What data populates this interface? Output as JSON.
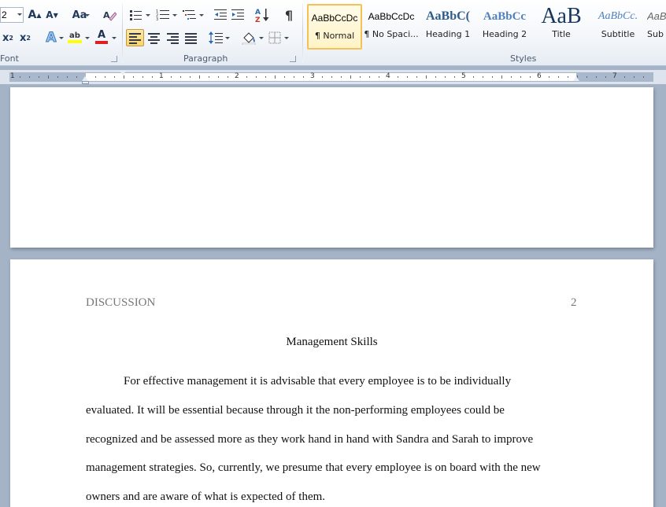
{
  "ribbon": {
    "font_size_value": "2",
    "groups": {
      "font": "Font",
      "paragraph": "Paragraph",
      "styles": "Styles"
    },
    "buttons": {
      "grow_font": "A",
      "shrink_font": "A",
      "change_case": "Aa",
      "subscript": "x",
      "superscript": "x",
      "text_effects": "A",
      "highlight": "ab",
      "font_color": "A",
      "sort": "A",
      "show_marks": "¶"
    },
    "styles": [
      {
        "sample": "AaBbCcDc",
        "name": "¶ Normal"
      },
      {
        "sample": "AaBbCcDc",
        "name": "¶ No Spaci..."
      },
      {
        "sample": "AaBbC(",
        "name": "Heading 1"
      },
      {
        "sample": "AaBbCc",
        "name": "Heading 2"
      },
      {
        "sample": "AaB",
        "name": "Title"
      },
      {
        "sample": "AaBbCc.",
        "name": "Subtitle"
      },
      {
        "sample": "AaBbC",
        "name": "Sub"
      }
    ],
    "colors": {
      "highlight": "#ffff00",
      "font_color": "#e02020",
      "heading": "#2e5c8a",
      "title": "#17365d"
    }
  },
  "ruler": {
    "numbers": [
      "1",
      "1",
      "2",
      "3",
      "4",
      "5",
      "6",
      "7"
    ]
  },
  "document": {
    "header": {
      "running_head": "DISCUSSION",
      "page_number": "2"
    },
    "title": "Management Skills",
    "lines": [
      "For effective management it is advisable that every employee is to be individually",
      "evaluated.  It will be essential because through it the non-performing  employees could be",
      "recognized and be assessed more as they work hand in hand with Sandra and Sarah to improve",
      "management strategies. So, currently, we presume that every employee is on board with the new",
      "owners and are aware of what is expected of them."
    ]
  }
}
